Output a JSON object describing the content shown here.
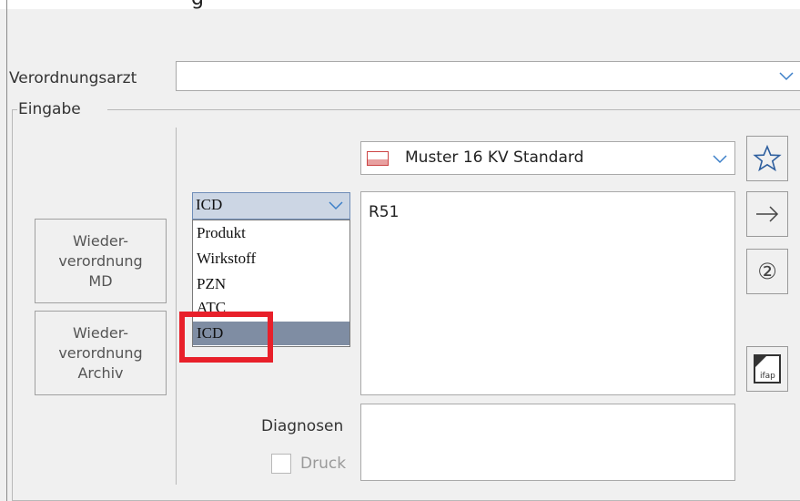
{
  "header": {
    "title_fragment": "g"
  },
  "verordnungsarzt": {
    "label": "Verordnungsarzt",
    "value": ""
  },
  "eingabe": {
    "group_label": "Eingabe",
    "form_select": {
      "value": "Muster 16 KV Standard",
      "flag_color": "#e8a0a0"
    },
    "search_type": {
      "selected": "ICD",
      "options": [
        "Produkt",
        "Wirkstoff",
        "PZN",
        "ATC",
        "ICD"
      ],
      "highlighted": "ICD"
    },
    "input_text": "R51",
    "buttons": {
      "wiederverordnung_md": "Wieder-\nverordnung\nMD",
      "wiederverordnung_archiv": "Wieder-\nverordnung\nArchiv"
    },
    "diagnosen": {
      "label": "Diagnosen",
      "value": ""
    },
    "druck": {
      "label": "Druck",
      "checked": false
    },
    "side_buttons": {
      "star_icon": "star-icon",
      "arrow_icon": "arrow-right-icon",
      "circled_two": "②",
      "ifap_label": "ifap"
    }
  },
  "colors": {
    "highlight_box": "#e8202a",
    "dropdown_selected": "#7f8da3"
  }
}
